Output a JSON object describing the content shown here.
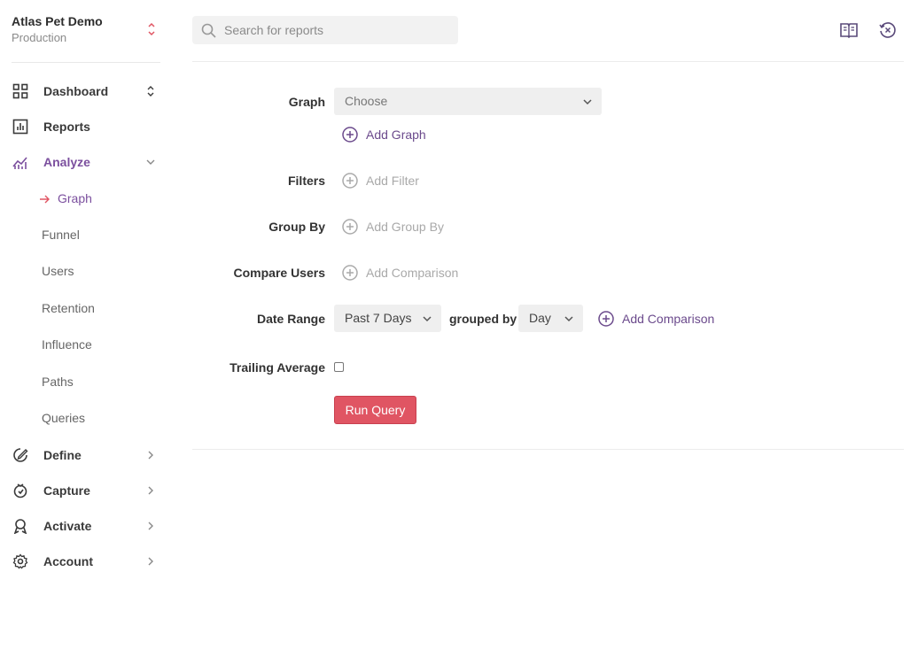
{
  "org": {
    "name": "Atlas Pet Demo",
    "environment": "Production"
  },
  "nav": {
    "dashboard": "Dashboard",
    "reports": "Reports",
    "analyze": "Analyze",
    "analyze_items": [
      "Graph",
      "Funnel",
      "Users",
      "Retention",
      "Influence",
      "Paths",
      "Queries"
    ],
    "define": "Define",
    "capture": "Capture",
    "activate": "Activate",
    "account": "Account"
  },
  "search": {
    "placeholder": "Search for reports"
  },
  "form": {
    "graph_label": "Graph",
    "graph_select": "Choose",
    "add_graph": "Add Graph",
    "filters_label": "Filters",
    "add_filter": "Add Filter",
    "group_by_label": "Group By",
    "add_group_by": "Add Group By",
    "compare_users_label": "Compare Users",
    "add_comparison": "Add Comparison",
    "date_range_label": "Date Range",
    "date_range_value": "Past 7 Days",
    "grouped_by_text": "grouped by",
    "granularity_value": "Day",
    "date_add_comparison": "Add Comparison",
    "trailing_average_label": "Trailing Average",
    "trailing_average_checked": false,
    "run_query": "Run Query"
  },
  "colors": {
    "accent": "#7b4f9e",
    "brand_red": "#e05563",
    "muted": "#a9a9a9"
  }
}
